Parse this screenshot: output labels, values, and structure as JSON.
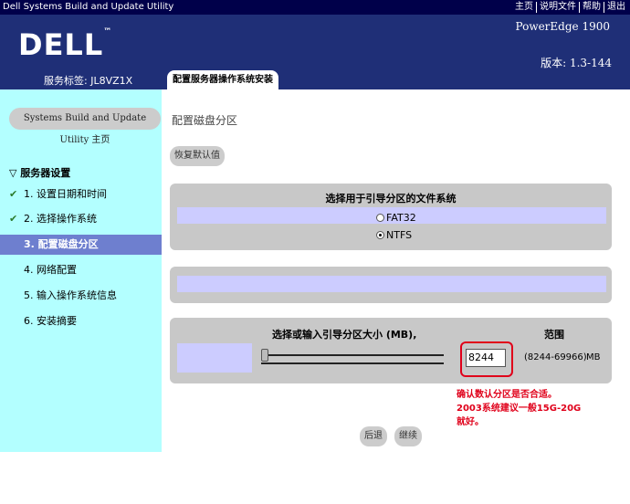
{
  "window": {
    "title": "Dell Systems Build and Update Utility",
    "links": [
      "主页",
      "说明文件",
      "帮助",
      "退出"
    ]
  },
  "header": {
    "logo": "DELL",
    "model": "PowerEdge 1900",
    "version": "版本: 1.3-144",
    "service_tag": "服务标签: JL8VZ1X",
    "tab": "配置服务器操作系统安装"
  },
  "sidebar": {
    "home_button": "Systems Build and Update Utility 主页",
    "section": "服务器设置",
    "items": [
      {
        "label": "1. 设置日期和时间",
        "done": true
      },
      {
        "label": "2. 选择操作系统",
        "done": true
      },
      {
        "label": "3. 配置磁盘分区",
        "done": false
      },
      {
        "label": "4. 网络配置",
        "done": false
      },
      {
        "label": "5. 输入操作系统信息",
        "done": false
      },
      {
        "label": "6. 安装摘要",
        "done": false
      }
    ],
    "active_index": 2
  },
  "main": {
    "title": "配置磁盘分区",
    "restore_button": "恢复默认值",
    "fs_title": "选择用于引导分区的文件系统",
    "fs_options": [
      "FAT32",
      "NTFS"
    ],
    "fs_selected": "NTFS",
    "size_label": "选择或输入引导分区大小 (MB),",
    "range_label": "范围",
    "size_value": "8244",
    "range_text": "(8244-69966)",
    "unit": "MB",
    "annotation": [
      "确认数认分区是否合适。",
      "2003系统建议一般15G-20G",
      "就好。"
    ],
    "back_button": "后退",
    "continue_button": "继续"
  },
  "colors": {
    "titlebar": "#00004a",
    "header": "#1f2f77",
    "sidebar": "#b3ffff",
    "active": "#6e7fcf",
    "panel": "#c8c8c8",
    "panel_inner": "#ccccff",
    "annotation": "#e0001a"
  }
}
